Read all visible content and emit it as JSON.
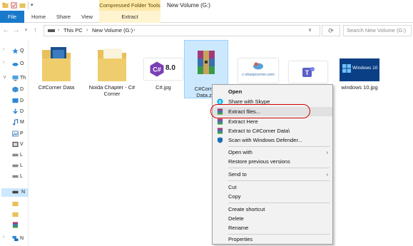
{
  "window": {
    "title": "New Volume (G:)",
    "contextual_tab_group": "Compressed Folder Tools"
  },
  "ribbon": {
    "tabs": [
      "File",
      "Home",
      "Share",
      "View",
      "Extract"
    ]
  },
  "address": {
    "segments": [
      "This PC",
      "New Volume (G:)"
    ],
    "search_placeholder": "Search New Volume (G:)"
  },
  "nav_pane": {
    "items": [
      "Q",
      "O",
      "Th",
      "D",
      "D",
      "D",
      "M",
      "P",
      "V",
      "L",
      "L",
      "L",
      "N",
      "",
      "",
      "",
      "N"
    ]
  },
  "files": [
    {
      "name": "C#Corner Data",
      "type": "folder"
    },
    {
      "name": "Noida Chapter - C# Corner",
      "type": "folder"
    },
    {
      "name": "C#.jpg",
      "type": "image",
      "thumb_text": "8.0"
    },
    {
      "name": "C#Corner Data.zip",
      "type": "zip",
      "selected": true
    },
    {
      "name": "c-sharpcorner.com",
      "type": "image"
    },
    {
      "name": "Teams",
      "type": "image"
    },
    {
      "name": "windows 10.jpg",
      "type": "image",
      "thumb_text": "Windows 10"
    }
  ],
  "context_menu": {
    "items": [
      {
        "label": "Open",
        "bold": true,
        "icon": "none",
        "submenu": false
      },
      {
        "label": "Share with Skype",
        "icon": "skype-icon",
        "submenu": false
      },
      {
        "label": "Extract files...",
        "icon": "winrar-icon",
        "submenu": false,
        "hover": true
      },
      {
        "label": "Extract Here",
        "icon": "winrar-icon",
        "submenu": false
      },
      {
        "label": "Extract to C#Corner Data\\",
        "icon": "winrar-icon",
        "submenu": false
      },
      {
        "label": "Scan with Windows Defender...",
        "icon": "defender-icon",
        "submenu": false
      },
      {
        "label": "Open with",
        "icon": "none",
        "submenu": true
      },
      {
        "label": "Restore previous versions",
        "icon": "none",
        "submenu": false
      },
      {
        "label": "Send to",
        "icon": "none",
        "submenu": true
      },
      {
        "label": "Cut",
        "icon": "none",
        "submenu": false
      },
      {
        "label": "Copy",
        "icon": "none",
        "submenu": false
      },
      {
        "label": "Create shortcut",
        "icon": "none",
        "submenu": false
      },
      {
        "label": "Delete",
        "icon": "none",
        "submenu": false
      },
      {
        "label": "Rename",
        "icon": "none",
        "submenu": false
      },
      {
        "label": "Properties",
        "icon": "none",
        "submenu": false
      }
    ]
  },
  "colors": {
    "accent": "#1979ca",
    "tool_tab": "#ffe9a8",
    "selection": "#cce8ff",
    "annotation": "#d10000"
  }
}
